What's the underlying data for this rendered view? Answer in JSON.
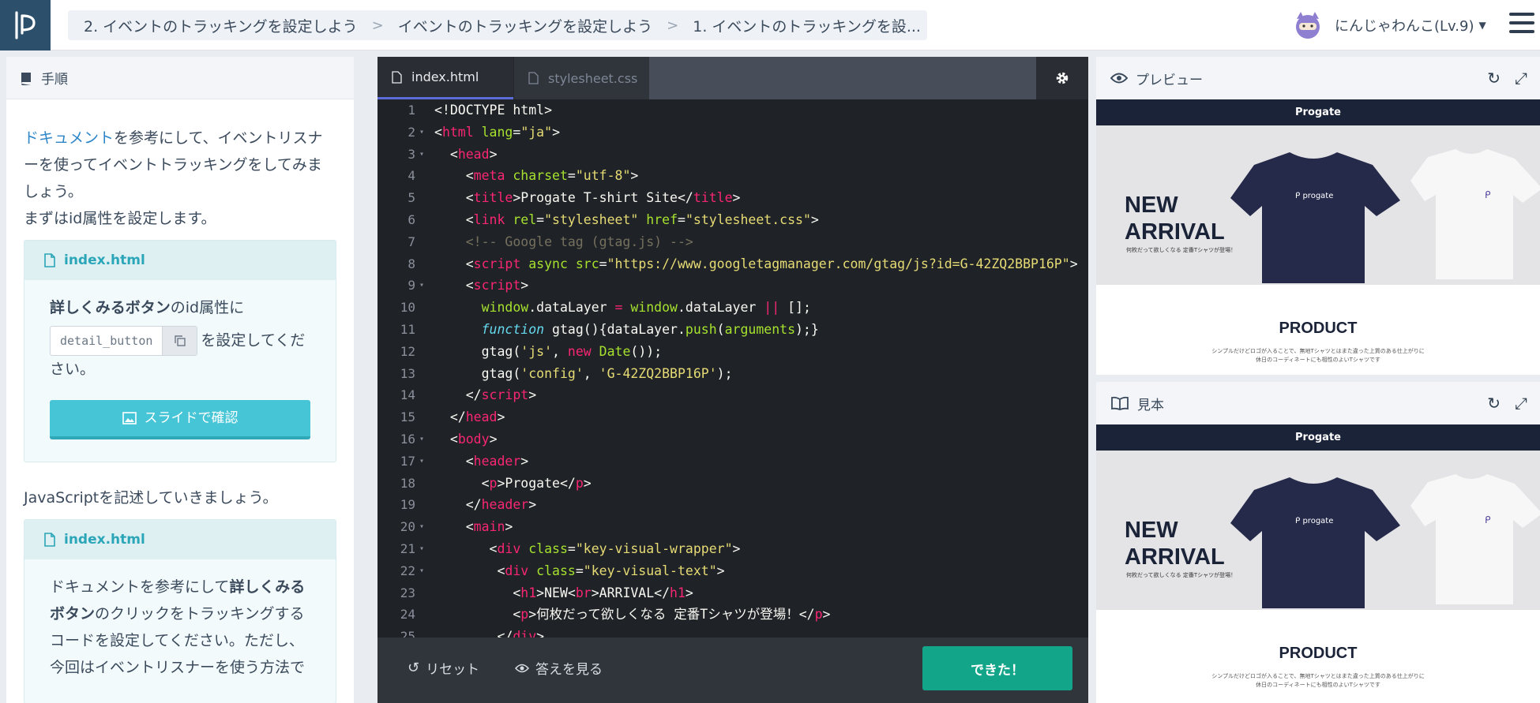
{
  "breadcrumb": {
    "items": [
      "2. イベントのトラッキングを設定しよう",
      "イベントのトラッキングを設定しよう",
      "1. イベントのトラッキングを設..."
    ],
    "separator": ">"
  },
  "user": {
    "name": "にんじゃわんこ(Lv.9)"
  },
  "instructions": {
    "header": "手順",
    "p1_link": "ドキュメント",
    "p1_rest": "を参考にして、イベントリスナーを使ってイベントトラッキングをしてみましょう。",
    "p2": "まずはid属性を設定します。",
    "card1": {
      "file": "index.html",
      "bold": "詳しくみるボタン",
      "text1": "のid属性に",
      "chip": "detail_button",
      "text2": "を設定してください。",
      "slide_button": "スライドで確認"
    },
    "p3": "JavaScriptを記述していきましょう。",
    "card2": {
      "file": "index.html",
      "t1": "ドキュメントを参考にして",
      "b1": "詳しくみるボタン",
      "t2": "のクリックをトラッキングするコードを設定してください。ただし、今回はイベントリスナーを使う方法で"
    }
  },
  "editor": {
    "tabs": [
      {
        "label": "index.html",
        "active": true
      },
      {
        "label": "stylesheet.css",
        "active": false
      }
    ],
    "footer": {
      "reset": "リセット",
      "answer": "答えを見る",
      "done": "できた！"
    }
  },
  "preview": {
    "header": "プレビュー",
    "site_nav": "Progate",
    "hero_title": "NEW ARRIVAL",
    "hero_sub": "何枚だって欲しくなる 定番Tシャツが登場！",
    "product_title": "PRODUCT",
    "product_desc_1": "シンプルだけどロゴが入ることで、無地Tシャツとはまた違った上質のある仕上がりに",
    "product_desc_2": "休日のコーディネートにも相性のよいTシャツです"
  },
  "sample": {
    "header": "見本",
    "site_nav": "Progate",
    "hero_title": "NEW ARRIVAL",
    "hero_sub": "何枚だって欲しくなる 定番Tシャツが登場！",
    "product_title": "PRODUCT",
    "product_desc_1": "シンプルだけどロゴが入ることで、無地Tシャツとはまた違った上質のある仕上がりに",
    "product_desc_2": "休日のコーディネートにも相性のよいTシャツです"
  },
  "colors": {
    "brand_dark": "#2c4f6b",
    "accent_teal": "#46c5d6",
    "done_green": "#13a589",
    "editor_bg": "#1f2227"
  },
  "code_lines": [
    [
      [
        "t",
        "<!DOCTYPE html>"
      ]
    ],
    [
      [
        "t",
        "<"
      ],
      [
        "g",
        "html"
      ],
      [
        "t",
        " "
      ],
      [
        "a",
        "lang"
      ],
      [
        "t",
        "="
      ],
      [
        "s",
        "\"ja\""
      ],
      [
        "t",
        ">"
      ]
    ],
    [
      [
        "t",
        "  <"
      ],
      [
        "g",
        "head"
      ],
      [
        "t",
        ">"
      ]
    ],
    [
      [
        "t",
        "    <"
      ],
      [
        "g",
        "meta"
      ],
      [
        "t",
        " "
      ],
      [
        "a",
        "charset"
      ],
      [
        "t",
        "="
      ],
      [
        "s",
        "\"utf-8\""
      ],
      [
        "t",
        ">"
      ]
    ],
    [
      [
        "t",
        "    <"
      ],
      [
        "g",
        "title"
      ],
      [
        "t",
        ">Progate T-shirt Site</"
      ],
      [
        "g",
        "title"
      ],
      [
        "t",
        ">"
      ]
    ],
    [
      [
        "t",
        "    <"
      ],
      [
        "g",
        "link"
      ],
      [
        "t",
        " "
      ],
      [
        "a",
        "rel"
      ],
      [
        "t",
        "="
      ],
      [
        "s",
        "\"stylesheet\""
      ],
      [
        "t",
        " "
      ],
      [
        "a",
        "href"
      ],
      [
        "t",
        "="
      ],
      [
        "s",
        "\"stylesheet.css\""
      ],
      [
        "t",
        ">"
      ]
    ],
    [
      [
        "c",
        "    <!-- Google tag (gtag.js) -->"
      ]
    ],
    [
      [
        "t",
        "    <"
      ],
      [
        "g",
        "script"
      ],
      [
        "t",
        " "
      ],
      [
        "a",
        "async"
      ],
      [
        "t",
        " "
      ],
      [
        "a",
        "src"
      ],
      [
        "t",
        "="
      ],
      [
        "s",
        "\"https://www.googletagmanager.com/gtag/js?id=G-42ZQ2BBP16P\""
      ],
      [
        "t",
        ">"
      ]
    ],
    [
      [
        "t",
        "    <"
      ],
      [
        "g",
        "script"
      ],
      [
        "t",
        ">"
      ]
    ],
    [
      [
        "t",
        "      "
      ],
      [
        "a",
        "window"
      ],
      [
        "t",
        ".dataLayer "
      ],
      [
        "o",
        "="
      ],
      [
        "t",
        " "
      ],
      [
        "a",
        "window"
      ],
      [
        "t",
        ".dataLayer "
      ],
      [
        "o",
        "||"
      ],
      [
        "t",
        " [];"
      ]
    ],
    [
      [
        "t",
        "      "
      ],
      [
        "k",
        "function"
      ],
      [
        "t",
        " gtag(){dataLayer."
      ],
      [
        "f",
        "push"
      ],
      [
        "t",
        "("
      ],
      [
        "f",
        "arguments"
      ],
      [
        "t",
        ");}"
      ]
    ],
    [
      [
        "t",
        "      gtag("
      ],
      [
        "s",
        "'js'"
      ],
      [
        "t",
        ", "
      ],
      [
        "o",
        "new"
      ],
      [
        "t",
        " "
      ],
      [
        "a",
        "Date"
      ],
      [
        "t",
        "());"
      ]
    ],
    [
      [
        "t",
        "      gtag("
      ],
      [
        "s",
        "'config'"
      ],
      [
        "t",
        ", "
      ],
      [
        "s",
        "'G-42ZQ2BBP16P'"
      ],
      [
        "t",
        ");"
      ]
    ],
    [
      [
        "t",
        "    </"
      ],
      [
        "g",
        "script"
      ],
      [
        "t",
        ">"
      ]
    ],
    [
      [
        "t",
        "  </"
      ],
      [
        "g",
        "head"
      ],
      [
        "t",
        ">"
      ]
    ],
    [
      [
        "t",
        "  <"
      ],
      [
        "g",
        "body"
      ],
      [
        "t",
        ">"
      ]
    ],
    [
      [
        "t",
        "    <"
      ],
      [
        "g",
        "header"
      ],
      [
        "t",
        ">"
      ]
    ],
    [
      [
        "t",
        "      <"
      ],
      [
        "g",
        "p"
      ],
      [
        "t",
        ">Progate</"
      ],
      [
        "g",
        "p"
      ],
      [
        "t",
        ">"
      ]
    ],
    [
      [
        "t",
        "    </"
      ],
      [
        "g",
        "header"
      ],
      [
        "t",
        ">"
      ]
    ],
    [
      [
        "t",
        "    <"
      ],
      [
        "g",
        "main"
      ],
      [
        "t",
        ">"
      ]
    ],
    [
      [
        "t",
        "       <"
      ],
      [
        "g",
        "div"
      ],
      [
        "t",
        " "
      ],
      [
        "a",
        "class"
      ],
      [
        "t",
        "="
      ],
      [
        "s",
        "\"key-visual-wrapper\""
      ],
      [
        "t",
        ">"
      ]
    ],
    [
      [
        "t",
        "        <"
      ],
      [
        "g",
        "div"
      ],
      [
        "t",
        " "
      ],
      [
        "a",
        "class"
      ],
      [
        "t",
        "="
      ],
      [
        "s",
        "\"key-visual-text\""
      ],
      [
        "t",
        ">"
      ]
    ],
    [
      [
        "t",
        "          <"
      ],
      [
        "g",
        "h1"
      ],
      [
        "t",
        ">NEW<"
      ],
      [
        "g",
        "br"
      ],
      [
        "t",
        ">ARRIVAL</"
      ],
      [
        "g",
        "h1"
      ],
      [
        "t",
        ">"
      ]
    ],
    [
      [
        "t",
        "          <"
      ],
      [
        "g",
        "p"
      ],
      [
        "t",
        ">何枚だって欲しくなる 定番Tシャツが登場！</"
      ],
      [
        "g",
        "p"
      ],
      [
        "t",
        ">"
      ]
    ],
    [
      [
        "t",
        "        </"
      ],
      [
        "g",
        "div"
      ],
      [
        "t",
        ">"
      ]
    ]
  ],
  "fold_lines": [
    2,
    3,
    9,
    16,
    17,
    20,
    21,
    22
  ]
}
